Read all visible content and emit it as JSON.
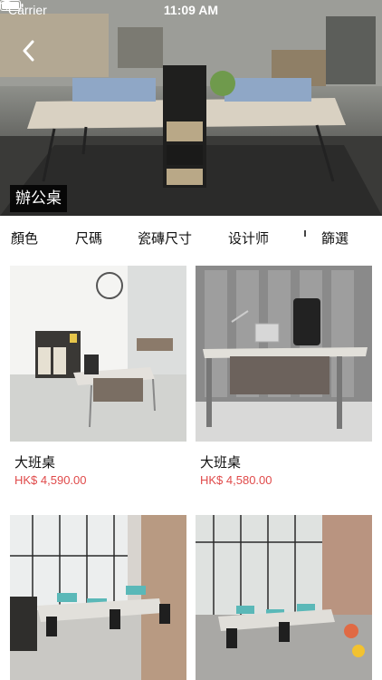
{
  "status_bar": {
    "carrier": "Carrier",
    "time": "11:09 AM"
  },
  "hero": {
    "title": "辦公桌"
  },
  "filters": [
    {
      "label": "顏色"
    },
    {
      "label": "尺碼"
    },
    {
      "label": "瓷磚尺寸"
    },
    {
      "label": "设计师"
    },
    {
      "label": "篩選"
    }
  ],
  "products": [
    {
      "name": "大班桌",
      "price": "HK$ 4,590.00"
    },
    {
      "name": "大班桌",
      "price": "HK$ 4,580.00"
    },
    {
      "name": "",
      "price": ""
    },
    {
      "name": "",
      "price": ""
    }
  ],
  "icons": {
    "back": "chevron-left-icon",
    "wifi": "wifi-icon",
    "battery": "battery-icon"
  },
  "colors": {
    "price": "#e04a4a",
    "tag_background": "#000000",
    "text": "#111111"
  }
}
